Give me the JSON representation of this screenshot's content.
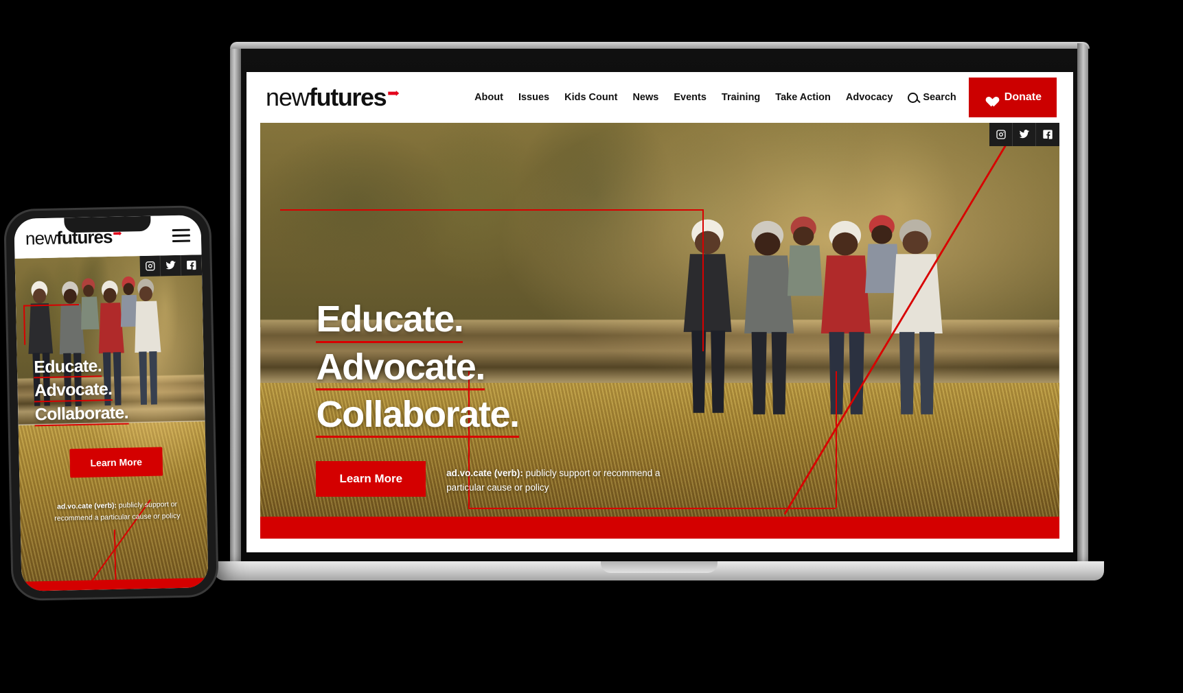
{
  "brand": {
    "logo_part1": "new",
    "logo_part2": "futures",
    "accent_color": "#e3051b",
    "red": "#d40000",
    "dark": "#111111"
  },
  "desktop": {
    "nav": [
      {
        "label": "About"
      },
      {
        "label": "Issues"
      },
      {
        "label": "Kids Count"
      },
      {
        "label": "News"
      },
      {
        "label": "Events"
      },
      {
        "label": "Training"
      },
      {
        "label": "Take Action"
      },
      {
        "label": "Advocacy"
      }
    ],
    "search_label": "Search",
    "search_icon": "magnifier-icon",
    "donate_label": "Donate",
    "donate_icon": "heart-icon",
    "social": [
      {
        "name": "instagram-icon",
        "label": "Instagram"
      },
      {
        "name": "twitter-icon",
        "label": "Twitter"
      },
      {
        "name": "facebook-icon",
        "label": "Facebook"
      }
    ],
    "hero": {
      "headline_lines": [
        "Educate.",
        "Advocate.",
        "Collaborate."
      ],
      "cta_label": "Learn More",
      "definition_term": "ad.vo.cate (verb):",
      "definition_text": " publicly support or recommend a particular cause or policy"
    }
  },
  "mobile": {
    "menu_icon": "hamburger-menu-icon",
    "social": [
      {
        "name": "instagram-icon",
        "label": "Instagram"
      },
      {
        "name": "twitter-icon",
        "label": "Twitter"
      },
      {
        "name": "facebook-icon",
        "label": "Facebook"
      }
    ],
    "hero": {
      "headline_lines": [
        "Educate.",
        "Advocate.",
        "Collaborate."
      ],
      "cta_label": "Learn More",
      "definition_term": "ad.vo.cate (verb):",
      "definition_text": " publicly support or recommend a particular cause or policy"
    }
  }
}
